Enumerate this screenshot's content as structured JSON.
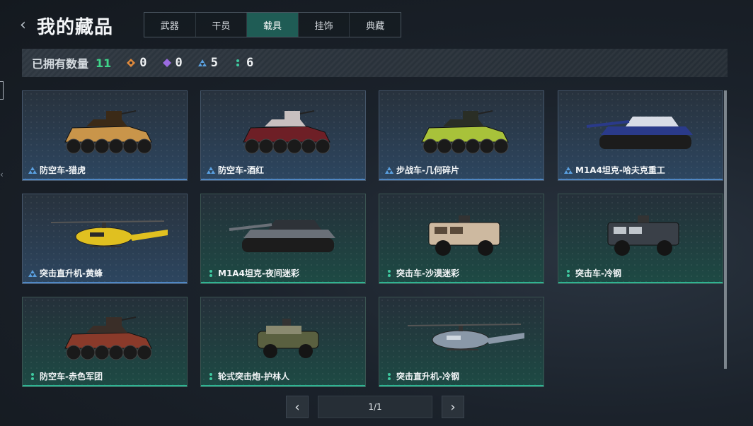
{
  "header": {
    "title": "我的藏品"
  },
  "tabs": [
    {
      "label": "武器"
    },
    {
      "label": "干员"
    },
    {
      "label": "载具"
    },
    {
      "label": "挂饰"
    },
    {
      "label": "典藏"
    }
  ],
  "summary": {
    "label": "已拥有数量",
    "count": "11",
    "rarities": [
      {
        "icon": "orange-diamond-icon",
        "color": "#e08a3c",
        "count": "0"
      },
      {
        "icon": "purple-diamond-icon",
        "color": "#9a6be0",
        "count": "0"
      },
      {
        "icon": "blue-triangle-icon",
        "color": "#5aa0e0",
        "count": "5"
      },
      {
        "icon": "green-dots-icon",
        "color": "#3fc9a0",
        "count": "6"
      }
    ]
  },
  "items": [
    {
      "name": "防空车-猎虎",
      "rarity": "blue",
      "vehicle": "apc",
      "colors": [
        "#c9954a",
        "#3b2a17"
      ]
    },
    {
      "name": "防空车-酒红",
      "rarity": "blue",
      "vehicle": "apc",
      "colors": [
        "#6e1f26",
        "#c8c0c0"
      ]
    },
    {
      "name": "步战车-几何碎片",
      "rarity": "blue",
      "vehicle": "apc",
      "colors": [
        "#a8c23a",
        "#2a2e25"
      ]
    },
    {
      "name": "M1A4坦克-哈夫克重工",
      "rarity": "blue",
      "vehicle": "tank",
      "colors": [
        "#2a3a8a",
        "#d8dce6"
      ]
    },
    {
      "name": "突击直升机-黄蜂",
      "rarity": "blue",
      "vehicle": "heli",
      "colors": [
        "#e0c020",
        "#2a2a2a"
      ]
    },
    {
      "name": "M1A4坦克-夜间迷彩",
      "rarity": "green",
      "vehicle": "tank",
      "colors": [
        "#6a7078",
        "#2e3238"
      ]
    },
    {
      "name": "突击车-沙漠迷彩",
      "rarity": "green",
      "vehicle": "mrap",
      "colors": [
        "#cdb9a0",
        "#5a4a3a"
      ]
    },
    {
      "name": "突击车-冷钢",
      "rarity": "green",
      "vehicle": "mrap",
      "colors": [
        "#3a4048",
        "#c0c6cc"
      ]
    },
    {
      "name": "防空车-赤色军团",
      "rarity": "green",
      "vehicle": "apc",
      "colors": [
        "#8a3a2a",
        "#3a2e28"
      ]
    },
    {
      "name": "轮式突击炮-护林人",
      "rarity": "green",
      "vehicle": "jeep",
      "colors": [
        "#5a6040",
        "#8a8a70"
      ]
    },
    {
      "name": "突击直升机-冷钢",
      "rarity": "green",
      "vehicle": "heli",
      "colors": [
        "#8a98a8",
        "#d0d8e0"
      ]
    }
  ],
  "pager": {
    "text": "1/1"
  }
}
